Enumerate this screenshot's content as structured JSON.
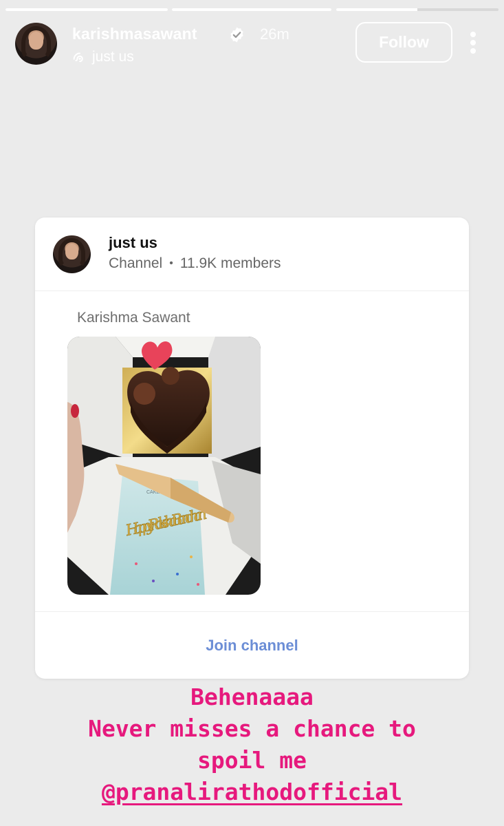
{
  "story": {
    "progress": [
      1,
      1,
      0.5,
      0
    ],
    "username": "karishmasawant",
    "verified": true,
    "time": "26m",
    "channel_name": "just us",
    "follow_label": "Follow"
  },
  "card": {
    "title": "just us",
    "type": "Channel",
    "separator": "•",
    "members": "11.9K members",
    "author": "Karishma Sawant",
    "photo_content": {
      "topper_text": "Happy Raksha Bandhan",
      "card_brand": "CAKE TOP"
    },
    "join_label": "Join channel"
  },
  "caption": {
    "line1": "Behenaaaa",
    "line2": "Never misses a chance to",
    "line3": "spoil me",
    "mention": "@pranalirathodofficial"
  },
  "colors": {
    "caption": "#e6197d",
    "join": "#6c8ed6",
    "background": "#ebebeb"
  },
  "icons": [
    "verified-badge-icon",
    "channel-broadcast-icon",
    "more-options-icon"
  ]
}
